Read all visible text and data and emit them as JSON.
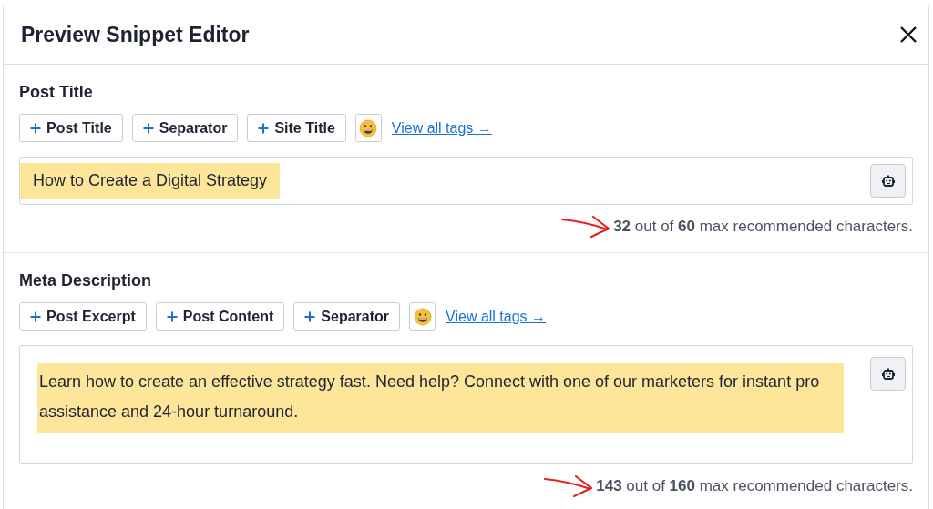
{
  "dialog": {
    "title": "Preview Snippet Editor"
  },
  "sections": [
    {
      "label": "Post Title",
      "kind": "line",
      "tags": [
        "Post Title",
        "Separator",
        "Site Title"
      ],
      "link": "View all tags →",
      "value": "How to Create a Digital Strategy",
      "highlighted": true,
      "count": "**32** out of **60** max recommended characters."
    },
    {
      "label": "Meta Description",
      "kind": "area",
      "tags": [
        "Post Excerpt",
        "Post Content",
        "Separator"
      ],
      "link": "View all tags →",
      "value": "Learn how to create an effective strategy fast. Need help? Connect with one of our marketers for instant pro assistance and 24-hour turnaround.",
      "highlighted": true,
      "count": "**143** out of **160** max recommended characters."
    }
  ]
}
